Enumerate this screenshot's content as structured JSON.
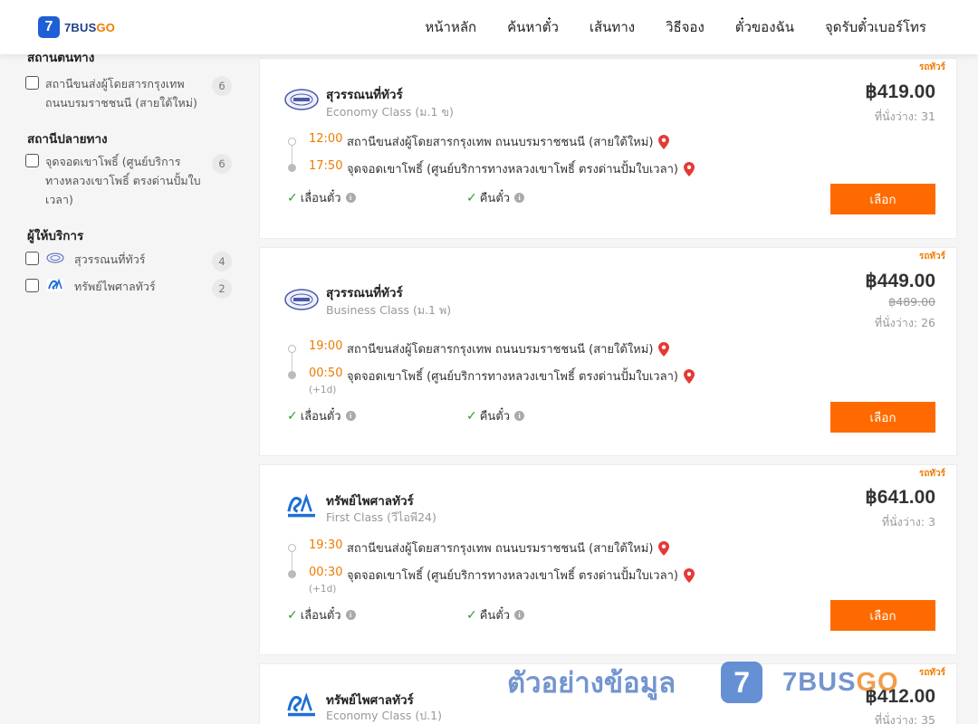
{
  "header": {
    "logo": {
      "prefix": "7BUS",
      "suffix": "GO",
      "mark": "7"
    },
    "nav": [
      "หน้าหลัก",
      "ค้นหาตั๋ว",
      "เส้นทาง",
      "วิธีจอง",
      "ตั๋วของฉัน",
      "จุดรับตั๋วเบอร์โทร"
    ]
  },
  "sidebar": {
    "origin": {
      "title": "สถานีต้นทาง",
      "items": [
        {
          "label": "สถานีขนส่งผู้โดยสารกรุงเทพ ถนนบรมราชชนนี (สายใต้ใหม่)",
          "count": "6"
        }
      ]
    },
    "destination": {
      "title": "สถานีปลายทาง",
      "items": [
        {
          "label": "จุดจอดเขาโพธิ์ (ศูนย์บริการทางหลวงเขาโพธิ์ ตรงด่านปั้มใบเวลา)",
          "count": "6"
        }
      ]
    },
    "operators": {
      "title": "ผู้ให้บริการ",
      "items": [
        {
          "label": "สุวรรณนที่ทัวร์",
          "count": "4",
          "icon": "suwannatee-logo-icon"
        },
        {
          "label": "ทรัพย์ไพศาลทัวร์",
          "count": "2",
          "icon": "sawasdee-logo-icon"
        }
      ]
    }
  },
  "trips": [
    {
      "tag": "รถทัวร์",
      "operator": "สุวรรณนที่ทัวร์",
      "class": "Economy Class (ม.1 ข)",
      "price": "฿419.00",
      "old_price": "",
      "seats": "ที่นั่งว่าง: 31",
      "depart_time": "12:00",
      "depart_station": "สถานีขนส่งผู้โดยสารกรุงเทพ ถนนบรมราชชนนี (สายใต้ใหม่)",
      "arrive_time": "17:50",
      "arrive_station": "จุดจอดเขาโพธิ์ (ศูนย์บริการทางหลวงเขาโพธิ์ ตรงด่านปั้มใบเวลา)",
      "plus_day": "",
      "feature_1": "เลื่อนตั๋ว",
      "feature_2": "คืนตั๋ว",
      "button": "เลือก"
    },
    {
      "tag": "รถทัวร์",
      "operator": "สุวรรณนที่ทัวร์",
      "class": "Business Class (ม.1 พ)",
      "price": "฿449.00",
      "old_price": "฿489.00",
      "seats": "ที่นั่งว่าง: 26",
      "depart_time": "19:00",
      "depart_station": "สถานีขนส่งผู้โดยสารกรุงเทพ ถนนบรมราชชนนี (สายใต้ใหม่)",
      "arrive_time": "00:50",
      "arrive_station": "จุดจอดเขาโพธิ์ (ศูนย์บริการทางหลวงเขาโพธิ์ ตรงด่านปั้มใบเวลา)",
      "plus_day": "(+1d)",
      "feature_1": "เลื่อนตั๋ว",
      "feature_2": "คืนตั๋ว",
      "button": "เลือก"
    },
    {
      "tag": "รถทัวร์",
      "operator": "ทรัพย์ไพศาลทัวร์",
      "class": "First Class (วีไอพี24)",
      "price": "฿641.00",
      "old_price": "",
      "seats": "ที่นั่งว่าง: 3",
      "depart_time": "19:30",
      "depart_station": "สถานีขนส่งผู้โดยสารกรุงเทพ ถนนบรมราชชนนี (สายใต้ใหม่)",
      "arrive_time": "00:30",
      "arrive_station": "จุดจอดเขาโพธิ์ (ศูนย์บริการทางหลวงเขาโพธิ์ ตรงด่านปั้มใบเวลา)",
      "plus_day": "(+1d)",
      "feature_1": "เลื่อนตั๋ว",
      "feature_2": "คืนตั๋ว",
      "button": "เลือก"
    },
    {
      "tag": "รถทัวร์",
      "operator": "ทรัพย์ไพศาลทัวร์",
      "class": "Economy Class (ป.1)",
      "price": "฿412.00",
      "seats": "ที่นั่งว่าง: 35"
    }
  ],
  "watermark": {
    "text": "ตัวอย่างข้อมูล",
    "mark": "7",
    "logo_prefix": "7BUS",
    "logo_suffix": "GO"
  },
  "colors": {
    "brand_blue": "#1f5fd6",
    "accent_orange": "#ff6a00",
    "time_orange": "#f07a00",
    "check_green": "#2f9a2f",
    "pin_red": "#e53935"
  }
}
